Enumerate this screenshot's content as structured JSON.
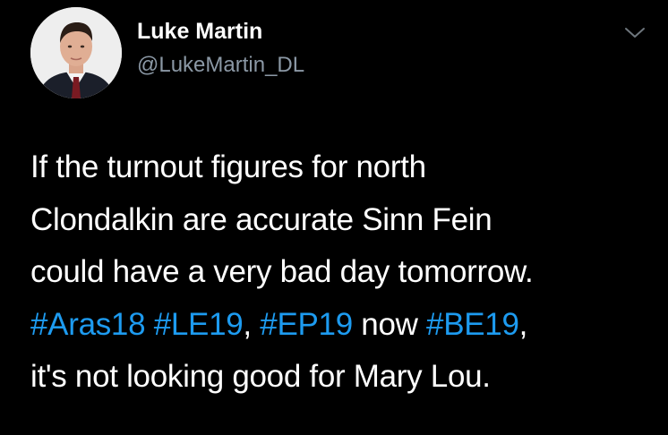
{
  "author": {
    "display_name": "Luke Martin",
    "handle": "@LukeMartin_DL"
  },
  "icons": {
    "menu": "chevron-down-icon",
    "avatar": "profile-photo"
  },
  "colors": {
    "background": "#000000",
    "text": "#ffffff",
    "secondary_text": "#8b98a5",
    "hashtag": "#1d9bf0"
  },
  "tweet": {
    "lines": [
      "If the turnout figures for north",
      "Clondalkin are accurate Sinn Fein",
      "could have a very bad day tomorrow."
    ],
    "hashtag_line": {
      "tag1": "#Aras18",
      "tag2": "#LE19",
      "sep1": ", ",
      "tag3": "#EP19",
      "mid": " now ",
      "tag4": "#BE19",
      "end": ","
    },
    "last_line": "it's not looking good for Mary Lou."
  }
}
